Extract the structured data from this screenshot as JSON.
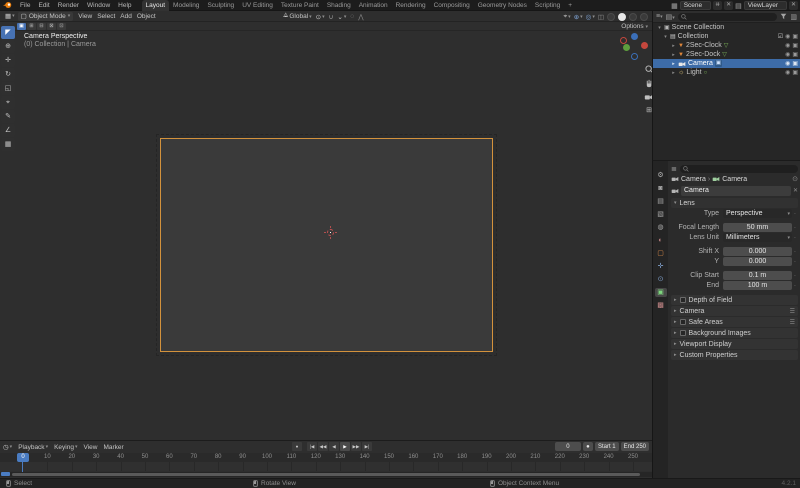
{
  "topbar": {
    "menus": [
      "File",
      "Edit",
      "Render",
      "Window",
      "Help"
    ],
    "tabs": [
      "Layout",
      "Modeling",
      "Sculpting",
      "UV Editing",
      "Texture Paint",
      "Shading",
      "Animation",
      "Rendering",
      "Compositing",
      "Geometry Nodes",
      "Scripting"
    ],
    "active_tab": "Layout",
    "add_tab_label": "+",
    "scene": "Scene",
    "view_layer": "ViewLayer"
  },
  "viewport": {
    "header": {
      "mode": "Object Mode",
      "menus": [
        "View",
        "Select",
        "Add",
        "Object"
      ],
      "orientation": "Global",
      "options": "Options"
    },
    "overlay": {
      "title": "Camera Perspective",
      "subtitle": "(0) Collection | Camera"
    }
  },
  "outliner": {
    "rows": [
      {
        "label": "Scene Collection"
      },
      {
        "label": "Collection"
      },
      {
        "label": "2Sec-Clock"
      },
      {
        "label": "2Sec-Dock"
      },
      {
        "label": "Camera",
        "selected": true
      },
      {
        "label": "Light"
      }
    ]
  },
  "properties": {
    "breadcrumb": [
      "Camera",
      "Camera"
    ],
    "name_field": "Camera",
    "lens": {
      "title": "Lens",
      "type_label": "Type",
      "type_value": "Perspective",
      "focal_label": "Focal Length",
      "focal_value": "50 mm",
      "unit_label": "Lens Unit",
      "unit_value": "Millimeters",
      "shift_label": "Shift X",
      "shift_x": "0.000",
      "y_label": "Y",
      "shift_y": "0.000",
      "clip_label": "Clip Start",
      "clip_start": "0.1 m",
      "end_label": "End",
      "clip_end": "100 m"
    },
    "panels": [
      {
        "label": "Depth of Field",
        "checkbox": true,
        "grip": false
      },
      {
        "label": "Camera",
        "checkbox": false,
        "grip": true
      },
      {
        "label": "Safe Areas",
        "checkbox": true,
        "grip": true
      },
      {
        "label": "Background Images",
        "checkbox": true,
        "grip": false
      },
      {
        "label": "Viewport Display",
        "checkbox": false,
        "grip": false
      },
      {
        "label": "Custom Properties",
        "checkbox": false,
        "grip": false
      }
    ]
  },
  "timeline": {
    "menus": [
      "Playback",
      "Keying",
      "View",
      "Marker"
    ],
    "ticks": [
      10,
      20,
      30,
      40,
      50,
      60,
      70,
      80,
      90,
      100,
      110,
      120,
      130,
      140,
      150,
      160,
      170,
      180,
      190,
      200,
      210,
      220,
      230,
      240,
      250
    ],
    "current_frame": "0",
    "start": "Start 1",
    "end": "End 250"
  },
  "statusbar": {
    "select": "Select",
    "rotate": "Rotate View",
    "context": "Object Context Menu",
    "version": "4.2.1"
  },
  "colors": {
    "accent_blue": "#4772b3",
    "selected_row": "#3d6ca8",
    "camera_border": "#d3923c",
    "mesh_orange": "#e0873a",
    "data_green": "#7ed87e"
  }
}
